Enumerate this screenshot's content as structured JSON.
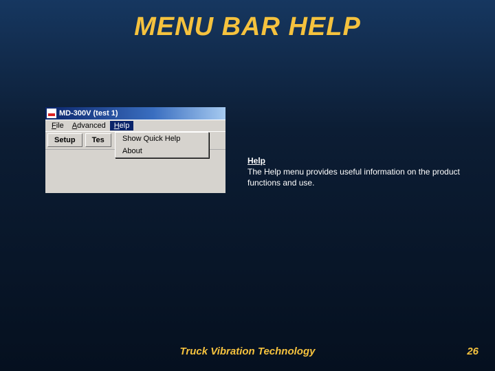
{
  "slide": {
    "title": "MENU BAR HELP",
    "footer": "Truck Vibration Technology",
    "page_number": "26"
  },
  "window": {
    "title": "MD-300V  (test 1)",
    "menubar": {
      "file_prefix": "F",
      "file_rest": "ile",
      "adv_prefix": "A",
      "adv_rest": "dvanced",
      "help_prefix": "H",
      "help_rest": "elp"
    },
    "tabs": {
      "setup": "Setup",
      "test_partial": "Tes"
    },
    "dropdown": {
      "show_quick_help": "Show Quick Help",
      "about": "About"
    }
  },
  "help_box": {
    "title": "Help",
    "body": "The Help menu provides useful information on the product functions and use."
  }
}
